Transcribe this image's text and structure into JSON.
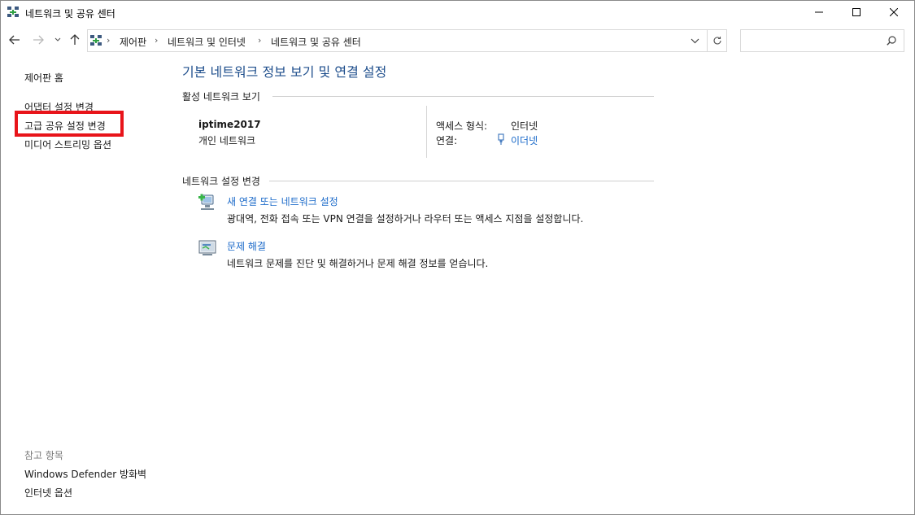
{
  "window": {
    "title": "네트워크 및 공유 센터",
    "icon": "network-icon",
    "controls": {
      "minimize": "minimize-icon",
      "maximize": "maximize-icon",
      "close": "close-icon"
    }
  },
  "address_bar": {
    "breadcrumb": [
      "제어판",
      "네트워크 및 인터넷",
      "네트워크 및 공유 센터"
    ],
    "separator": "›",
    "search_placeholder": ""
  },
  "sidebar": {
    "links": [
      "제어판 홈",
      "어댑터 설정 변경",
      "고급 공유 설정 변경",
      "미디어 스트리밍 옵션"
    ],
    "highlighted_link": "고급 공유 설정 변경",
    "highlight_color": "#e8141a",
    "see_also": {
      "title": "참고 항목",
      "links": [
        "Windows Defender 방화벽",
        "인터넷 옵션"
      ]
    }
  },
  "main": {
    "heading": "기본 네트워크 정보 보기 및 연결 설정",
    "active_networks": {
      "title": "활성 네트워크 보기",
      "network_name": "iptime2017",
      "network_type": "개인 네트워크",
      "access_type_label": "액세스 형식:",
      "access_type_value": "인터넷",
      "connection_label": "연결:",
      "connection_value": "이더넷"
    },
    "change_settings": {
      "title": "네트워크 설정 변경",
      "tasks": [
        {
          "link": "새 연결 또는 네트워크 설정",
          "description": "광대역, 전화 접속 또는 VPN 연결을 설정하거나 라우터 또는 액세스 지점을 설정합니다."
        },
        {
          "link": "문제 해결",
          "description": "네트워크 문제를 진단 및 해결하거나 문제 해결 정보를 얻습니다."
        }
      ]
    }
  },
  "colors": {
    "heading": "#1e4e8c",
    "link": "#1b6ac9"
  }
}
